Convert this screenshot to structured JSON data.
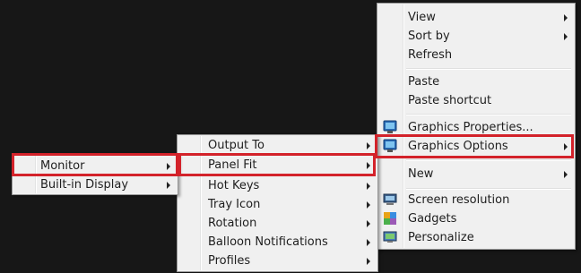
{
  "desktop_menu": {
    "items": [
      {
        "label": "View",
        "submenu": true
      },
      {
        "label": "Sort by",
        "submenu": true
      },
      {
        "label": "Refresh",
        "submenu": false
      },
      {
        "label": "Paste",
        "submenu": false
      },
      {
        "label": "Paste shortcut",
        "submenu": false
      },
      {
        "label": "Graphics Properties...",
        "submenu": false,
        "icon": "graphics-properties-icon"
      },
      {
        "label": "Graphics Options",
        "submenu": true,
        "icon": "graphics-options-icon",
        "highlighted": true
      },
      {
        "label": "New",
        "submenu": true
      },
      {
        "label": "Screen resolution",
        "submenu": false,
        "icon": "screen-resolution-icon"
      },
      {
        "label": "Gadgets",
        "submenu": false,
        "icon": "gadgets-icon"
      },
      {
        "label": "Personalize",
        "submenu": false,
        "icon": "personalize-icon"
      }
    ]
  },
  "graphics_options_menu": {
    "items": [
      {
        "label": "Output To",
        "submenu": true
      },
      {
        "label": "Panel Fit",
        "submenu": true,
        "highlighted": true
      },
      {
        "label": "Hot Keys",
        "submenu": true
      },
      {
        "label": "Tray Icon",
        "submenu": true
      },
      {
        "label": "Rotation",
        "submenu": true
      },
      {
        "label": "Balloon Notifications",
        "submenu": true
      },
      {
        "label": "Profiles",
        "submenu": true
      }
    ]
  },
  "panel_fit_menu": {
    "items": [
      {
        "label": "Monitor",
        "submenu": true,
        "highlighted": true
      },
      {
        "label": "Built-in Display",
        "submenu": true
      }
    ]
  },
  "colors": {
    "desktop_background": "#171717",
    "menu_background": "#f0f0f0",
    "highlight_outline": "#d3222a"
  }
}
